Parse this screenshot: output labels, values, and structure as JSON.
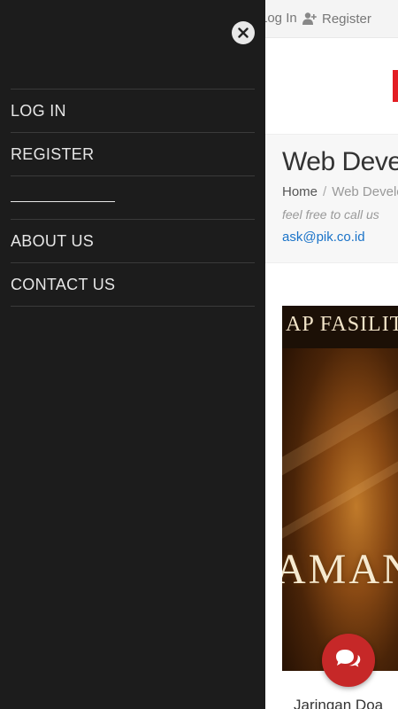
{
  "topbar": {
    "login_label": "Log In",
    "register_label": "Register",
    "register_icon": "user-plus-icon"
  },
  "header": {
    "brand_color": "#e31e24"
  },
  "title_area": {
    "page_title": "Web Development",
    "breadcrumb": [
      "Home",
      "Web Development"
    ],
    "tagline": "feel free to call us",
    "email": "ask@pik.co.id"
  },
  "banner": {
    "top_text": "AP FASILITAS",
    "big_text": "AMAN"
  },
  "caption": "Jaringan Doa",
  "drawer": {
    "close_icon": "close-icon",
    "items": [
      "LOG IN",
      "REGISTER",
      "",
      "ABOUT US",
      "CONTACT US"
    ]
  },
  "chat": {
    "icon": "chat-bubbles-icon",
    "color": "#c62828"
  },
  "colors": {
    "drawer_bg": "#1c1c1c",
    "link": "#1a73c8"
  }
}
